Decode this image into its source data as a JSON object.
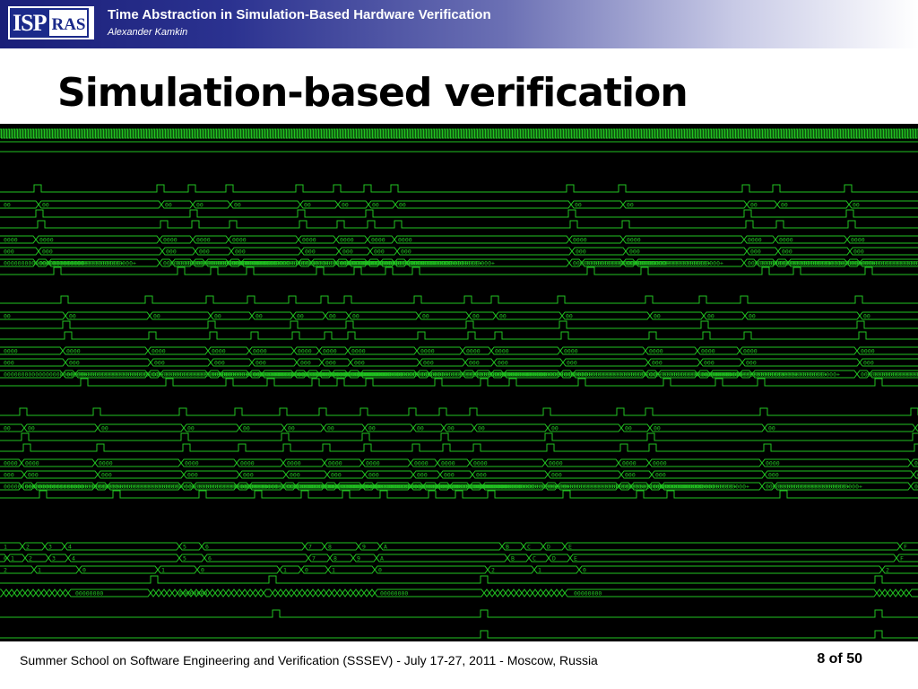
{
  "header": {
    "logo": {
      "left": "ISP",
      "right": "RAS"
    },
    "title": "Time Abstraction in Simulation-Based Hardware Verification",
    "author": "Alexander Kamkin"
  },
  "slide": {
    "title": "Simulation-based verification"
  },
  "waveform": {
    "trace_color": "#22c322",
    "background": "#000000",
    "bus_labels": {
      "hex2": "00",
      "hex4": "0000",
      "hex3": "000",
      "long": "00000000000000000000000+",
      "counter_a": [
        "1",
        "2",
        "3",
        "4",
        "5",
        "6",
        "7",
        "8",
        "9",
        "A",
        "B",
        "C",
        "D",
        "E",
        "F"
      ],
      "counter_b": [
        "0",
        "1",
        "2",
        "3",
        "4",
        "5",
        "6",
        "7",
        "8",
        "9",
        "A",
        "B",
        "C",
        "D",
        "E",
        "F"
      ],
      "counter_c": [
        "2",
        "1",
        "0",
        "1",
        "0",
        "1",
        "0",
        "1",
        "0",
        "2",
        "1",
        "0",
        "2"
      ],
      "wide": "00000000"
    }
  },
  "footer": {
    "text": "Summer School on Software Engineering and Verification (SSSEV) - July 17-27, 2011 - Moscow, Russia",
    "page": "8 of 50"
  }
}
